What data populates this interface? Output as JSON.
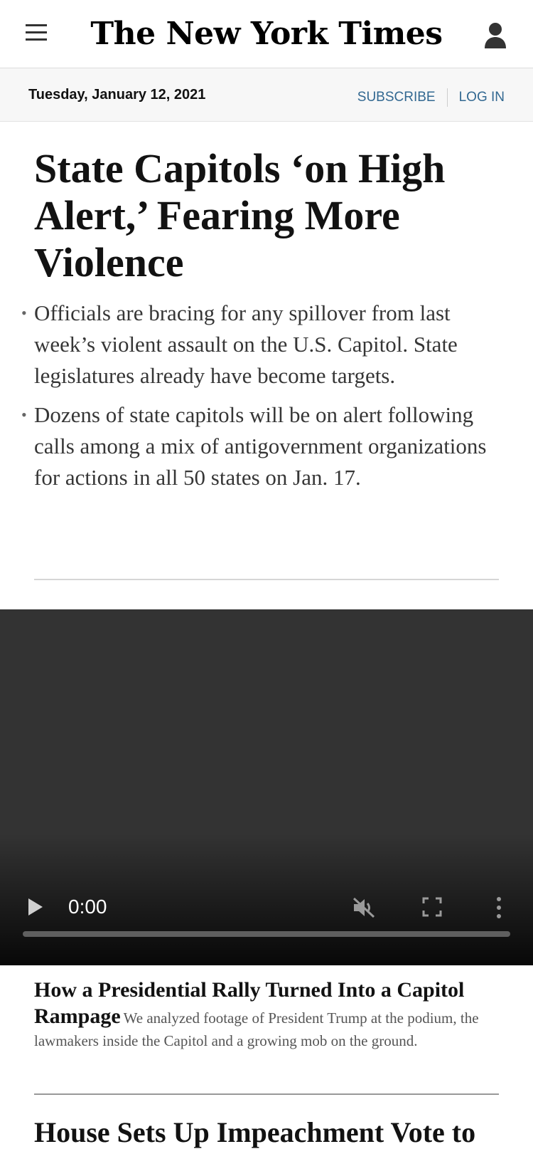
{
  "header": {
    "logo": "The New York Times",
    "menu_icon": "hamburger-menu-icon",
    "user_icon": "user-account-icon"
  },
  "datebar": {
    "date": "Tuesday, January 12, 2021",
    "subscribe": "SUBSCRIBE",
    "login": "LOG IN"
  },
  "article": {
    "headline": "State Capitols ‘on High Alert,’ Fearing More Violence",
    "summary": [
      "Officials are bracing for any spillover from last week’s violent assault on the U.S. Capitol. State legislatures already have become targets.",
      "Dozens of state capitols will be on alert following calls among a mix of antigovernment organizations for actions in all 50 states on Jan. 17."
    ]
  },
  "video": {
    "time": "0:00",
    "progress": 0,
    "icons": [
      "play-icon",
      "muted-icon",
      "fullscreen-icon",
      "more-options-icon"
    ]
  },
  "caption": {
    "title": "How a Presidential Rally Turned Into a Capitol Rampage",
    "summary": "We analyzed footage of President Trump at the podium, the lawmakers inside the Capitol and a growing mob on the ground."
  },
  "next_story": {
    "headline": "House Sets Up Impeachment Vote to"
  },
  "colors": {
    "link": "#326891",
    "video_bg": "#333333"
  }
}
